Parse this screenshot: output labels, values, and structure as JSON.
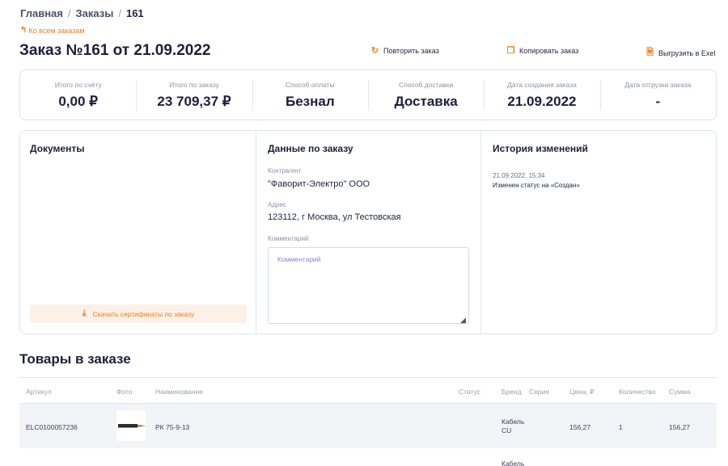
{
  "breadcrumb": {
    "home": "Главная",
    "orders": "Заказы",
    "current": "161",
    "separator": "/"
  },
  "back_link": {
    "icon": "arrow-up-left-icon",
    "label": "Ко всем заказам"
  },
  "title": "Заказ №161 от 21.09.2022",
  "actions": {
    "repeat": {
      "icon": "refresh-icon",
      "label": "Повторить заказ"
    },
    "copy": {
      "icon": "copy-icon",
      "label": "Копировать заказ"
    },
    "export": {
      "icon": "excel-file-icon",
      "label": "Выгрузить в Exel"
    }
  },
  "summary": [
    {
      "label": "Итого по счёту",
      "value": "0,00 ₽"
    },
    {
      "label": "Итого по заказу",
      "value": "23 709,37 ₽"
    },
    {
      "label": "Способ оплаты",
      "value": "Безнал"
    },
    {
      "label": "Способ доставки",
      "value": "Доставка"
    },
    {
      "label": "Дата создания заказа",
      "value": "21.09.2022"
    },
    {
      "label": "Дата отгрузки заказа",
      "value": "-"
    }
  ],
  "documents": {
    "title": "Документы",
    "download_button": {
      "icon": "download-icon",
      "label": "Скачать сертификаты по заказу"
    }
  },
  "order_data": {
    "title": "Данные по заказу",
    "counterparty_label": "Контрагент",
    "counterparty_value": "\"Фаворит-Электро\" ООО",
    "address_label": "Адрес",
    "address_value": "123112, г Москва, ул Тестовская",
    "comment_label": "Комментарий",
    "comment_placeholder": "Комментарий",
    "comment_value": ""
  },
  "history": {
    "title": "История изменений",
    "entries": [
      {
        "date": "21.09.2022, 15:34",
        "text": "Изменен статус на «Создан»"
      }
    ]
  },
  "goods": {
    "title": "Товары в заказе",
    "columns": {
      "article": "Артикул",
      "photo": "Фото",
      "name": "Наименование",
      "status": "Статус",
      "brand": "Бренд",
      "series": "Серия",
      "price": "Цена, ₽",
      "quantity": "Количество",
      "sum": "Сумма"
    },
    "rows": [
      {
        "article": "ELC0100057236",
        "photo_icon": "cable-photo",
        "name": "РК 75-9-13",
        "status": "",
        "brand_line1": "Кабель",
        "brand_line2": "CU",
        "price": "156,27",
        "quantity": "1",
        "sum": "156,27"
      },
      {
        "brand_line1": "Кабель"
      }
    ]
  },
  "colors": {
    "accent": "#f07c1f",
    "text": "#1c1f3b",
    "muted": "#8d90a6",
    "border": "#dfe3ee",
    "row_bg": "#f3f4f8"
  }
}
